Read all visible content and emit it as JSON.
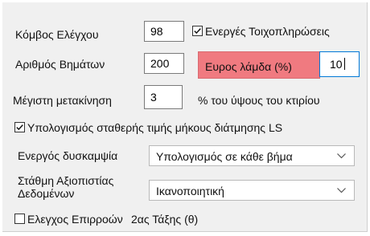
{
  "node": {
    "label": "Κόμβος Ελέγχου",
    "value": "98"
  },
  "active_fill": {
    "label": "Ενεργές Τοιχοπληρώσεις",
    "checked": true
  },
  "steps": {
    "label": "Αριθμός Βημάτων",
    "value": "200"
  },
  "lambda_range": {
    "label": "Ευρος λάμδα (%)",
    "value": "10",
    "highlight_color": "#f07a80"
  },
  "max_displacement": {
    "label": "Μέγιστη μετακίνηση",
    "value": "3",
    "unit": "% του ύψους του κτιρίου"
  },
  "constant_ls": {
    "label": "Υπολογισμός σταθερής τιμής μήκους διάτμησης LS",
    "checked": true
  },
  "active_stiffness": {
    "label": "Ενεργός δυσκαμψία",
    "selected": "Υπολογισμός σε κάθε βήμα",
    "icon": "chevron-down-icon"
  },
  "data_reliability": {
    "label_line1": "Στάθμη Αξιοπιστίας",
    "label_line2": "Δεδομένων",
    "selected": "Ικανοποιητική",
    "icon": "chevron-down-icon"
  },
  "second_order": {
    "label": "Ελεγχος Επιρροών",
    "label_suffix": "2ας Τάξης (θ)",
    "checked": false
  }
}
